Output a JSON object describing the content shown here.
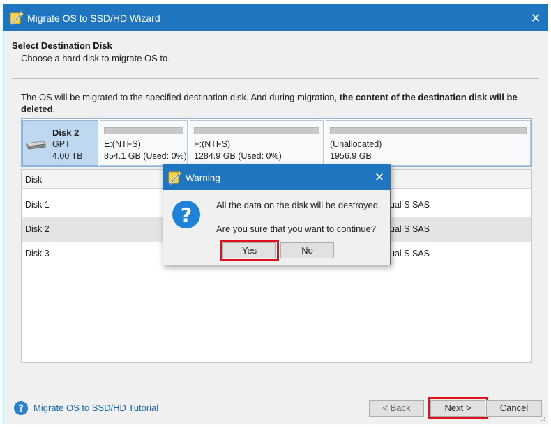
{
  "window": {
    "title": "Migrate OS to SSD/HD Wizard",
    "close_glyph": "✕"
  },
  "header": {
    "title": "Select Destination Disk",
    "subtitle": "Choose a hard disk to migrate OS to."
  },
  "notice": {
    "text_plain": "The OS will be migrated to the specified destination disk. And during migration, ",
    "text_bold": "the content of the destination disk will be deleted",
    "text_end": "."
  },
  "disk_map": {
    "disk": {
      "name": "Disk 2",
      "type": "GPT",
      "size": "4.00 TB",
      "icon": "hard-disk-icon"
    },
    "partitions": [
      {
        "name": "E:(NTFS)",
        "info": "854.1 GB (Used: 0%)"
      },
      {
        "name": "F:(NTFS)",
        "info": "1284.9 GB (Used: 0%)"
      },
      {
        "name": "(Unallocated)",
        "info": "1956.9 GB"
      }
    ]
  },
  "disk_list": {
    "header": "Disk",
    "rows": [
      {
        "disk": "Disk 1",
        "model": "ual S SAS",
        "selected": false
      },
      {
        "disk": "Disk 2",
        "model": "ual S SAS",
        "selected": true
      },
      {
        "disk": "Disk 3",
        "model": "ual S SAS",
        "selected": false
      }
    ]
  },
  "footer": {
    "tutorial_link": "Migrate OS to SSD/HD Tutorial",
    "back_label": "< Back",
    "next_label": "Next >",
    "cancel_label": "Cancel"
  },
  "dialog": {
    "title": "Warning",
    "message1": "All the data on the disk will be destroyed.",
    "message2": "Are you sure that you want to continue?",
    "yes_label": "Yes",
    "no_label": "No",
    "close_glyph": "✕",
    "icon": "question-icon"
  },
  "colors": {
    "titlebar": "#1f75c0",
    "highlight": "#e0111a",
    "link": "#1566b4",
    "selected_disk": "#bfd7ef"
  }
}
